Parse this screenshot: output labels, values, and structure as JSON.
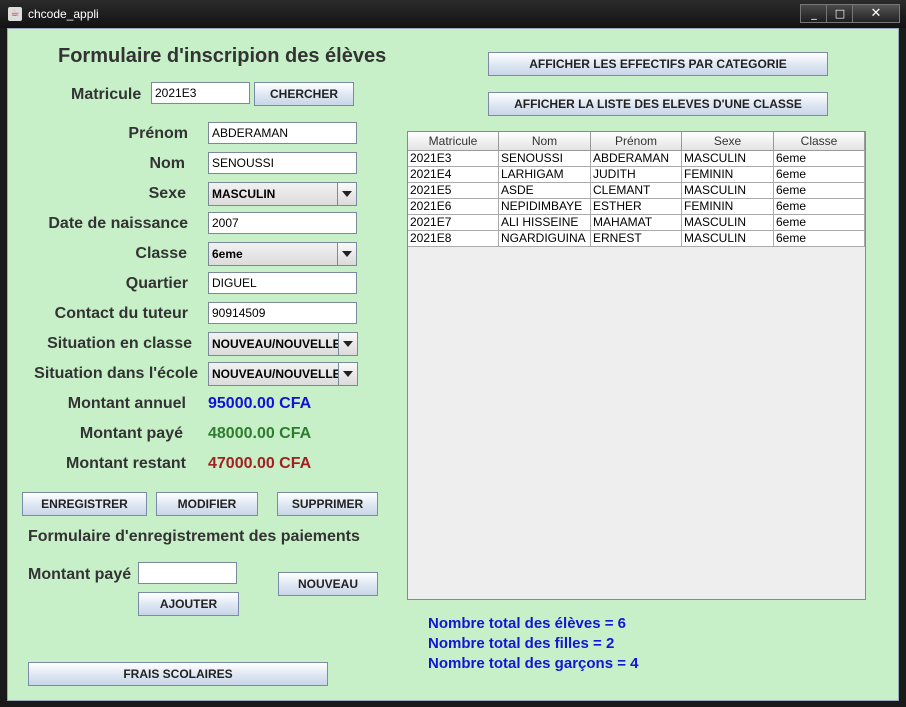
{
  "window": {
    "title": "chcode_appli",
    "min": "_",
    "max": "□",
    "close": "✕",
    "app_icon": "java-icon"
  },
  "form": {
    "title": "Formulaire d'inscripion des élèves",
    "matricule_label": "Matricule",
    "matricule_value": "2021E3",
    "search_button": "CHERCHER",
    "prenom_label": "Prénom",
    "prenom_value": "ABDERAMAN",
    "nom_label": "Nom",
    "nom_value": "SENOUSSI",
    "sexe_label": "Sexe",
    "sexe_value": "MASCULIN",
    "naissance_label": "Date de naissance",
    "naissance_value": "2007",
    "classe_label": "Classe",
    "classe_value": "6eme",
    "quartier_label": "Quartier",
    "quartier_value": "DIGUEL",
    "contact_label": "Contact du tuteur",
    "contact_value": "90914509",
    "situation_classe_label": "Situation en classe",
    "situation_classe_value": "NOUVEAU/NOUVELLE",
    "situation_ecole_label": "Situation dans l'école",
    "situation_ecole_value": "NOUVEAU/NOUVELLE",
    "annuel_label": "Montant annuel",
    "annuel_value": "95000.00 CFA",
    "paye_label": "Montant payé",
    "paye_value": "48000.00 CFA",
    "restant_label": "Montant restant",
    "restant_value": "47000.00 CFA",
    "enregistrer": "ENREGISTRER",
    "modifier": "MODIFIER",
    "supprimer": "SUPPRIMER"
  },
  "colors": {
    "annuel": "#1111d8",
    "paye": "#2e7d2e",
    "restant": "#a32020",
    "background": "#c7f0c9"
  },
  "payment": {
    "title": "Formulaire d'enregistrement des paiements",
    "label": "Montant payé",
    "value": "",
    "ajouter": "AJOUTER",
    "nouveau": "NOUVEAU",
    "frais": "FRAIS SCOLAIRES"
  },
  "actions": {
    "effectifs": "AFFICHER LES EFFECTIFS PAR CATEGORIE",
    "liste": "AFFICHER LA LISTE DES ELEVES D'UNE CLASSE"
  },
  "table": {
    "columns": [
      "Matricule",
      "Nom",
      "Prénom",
      "Sexe",
      "Classe"
    ],
    "rows": [
      [
        "2021E3",
        "SENOUSSI",
        "ABDERAMAN",
        "MASCULIN",
        "6eme"
      ],
      [
        "2021E4",
        "LARHIGAM",
        "JUDITH",
        "FEMININ",
        "6eme"
      ],
      [
        "2021E5",
        "ASDE",
        "CLEMANT",
        "MASCULIN",
        "6eme"
      ],
      [
        "2021E6",
        "NEPIDIMBAYE",
        "ESTHER",
        "FEMININ",
        "6eme"
      ],
      [
        "2021E7",
        "ALI HISSEINE",
        "MAHAMAT",
        "MASCULIN",
        "6eme"
      ],
      [
        "2021E8",
        "NGARDIGUINA",
        "ERNEST",
        "MASCULIN",
        "6eme"
      ]
    ]
  },
  "stats": {
    "total": "Nombre total des élèves = 6",
    "filles": "Nombre total des filles = 2",
    "garcons": "Nombre total des garçons = 4"
  }
}
